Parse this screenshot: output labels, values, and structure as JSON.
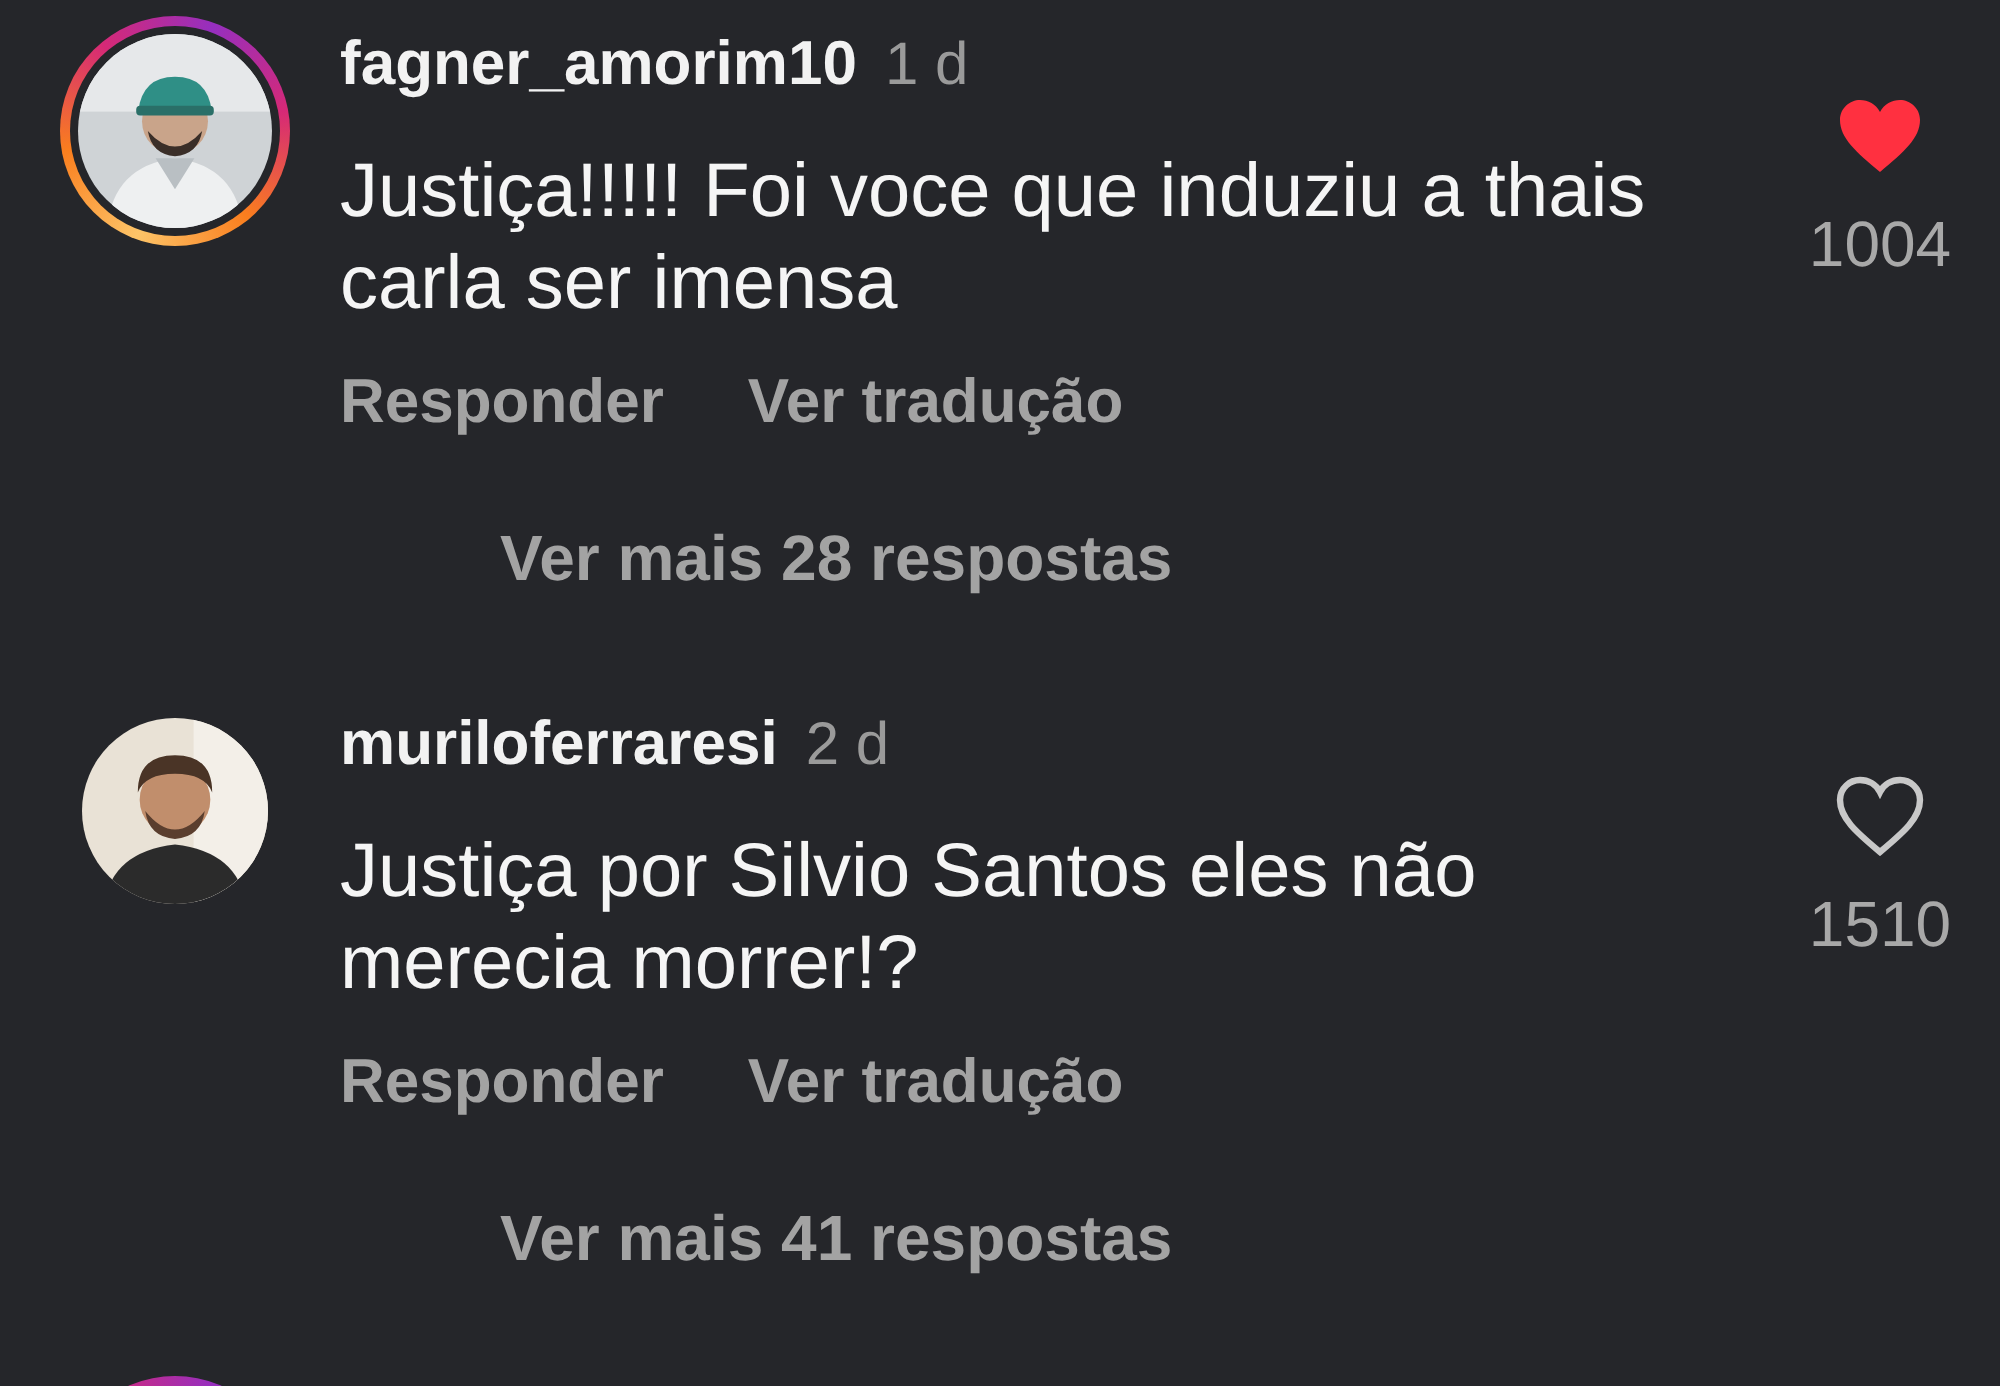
{
  "comments": [
    {
      "kind": "full",
      "story_ring": true,
      "username": "fagner_amorim10",
      "time": "1 d",
      "text": "Justiça!!!!! Foi voce que induziu a thais carla ser imensa",
      "liked": true,
      "likes": "1004",
      "actions": [
        "Responder",
        "Ver tradução"
      ],
      "more_replies": "Ver mais 28 respostas"
    },
    {
      "kind": "full",
      "story_ring": false,
      "username": "muriloferraresi",
      "time": "2 d",
      "text": "Justiça por Silvio Santos eles não merecia morrer!?",
      "liked": false,
      "likes": "1510",
      "actions": [
        "Responder",
        "Ver tradução"
      ],
      "more_replies": "Ver mais 41 respostas"
    },
    {
      "kind": "cut",
      "story_ring": true
    }
  ]
}
